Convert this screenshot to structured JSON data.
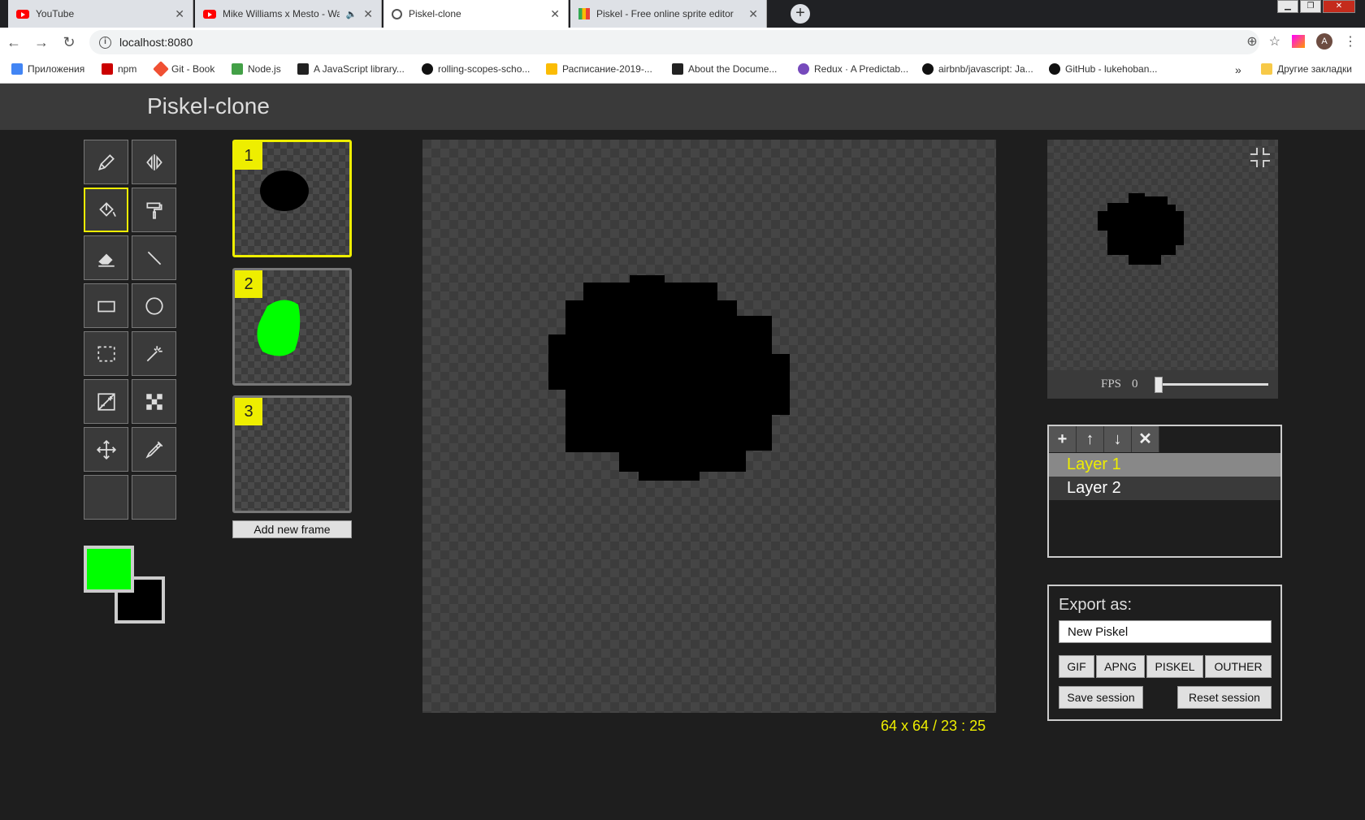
{
  "browser": {
    "tabs": [
      {
        "label": "YouTube",
        "icon": "youtube-icon"
      },
      {
        "label": "Mike Williams x Mesto - Wai",
        "icon": "youtube-icon"
      },
      {
        "label": "Piskel-clone",
        "icon": "globe-icon",
        "active": true
      },
      {
        "label": "Piskel - Free online sprite editor",
        "icon": "piskel-icon"
      }
    ],
    "url": "localhost:8080",
    "avatar_letter": "A",
    "bookmarks": [
      {
        "label": "Приложения",
        "color": "#4285f4"
      },
      {
        "label": "npm",
        "color": "#cb0000"
      },
      {
        "label": "Git - Book",
        "color": "#f05033"
      },
      {
        "label": "Node.js",
        "color": "#43a047"
      },
      {
        "label": "A JavaScript library...",
        "color": "#222222"
      },
      {
        "label": "rolling-scopes-scho...",
        "color": "#111111"
      },
      {
        "label": "Расписание-2019-...",
        "color": "#fbbc04"
      },
      {
        "label": "About the Docume...",
        "color": "#222222"
      },
      {
        "label": "Redux · A Predictab...",
        "color": "#764abc"
      },
      {
        "label": "airbnb/javascript: Ja...",
        "color": "#111111"
      },
      {
        "label": "GitHub - lukehoban...",
        "color": "#111111"
      }
    ],
    "overflow": "»",
    "other_bookmarks": "Другие закладки"
  },
  "app": {
    "title": "Piskel-clone",
    "tools": [
      "pen-icon",
      "mirror-pen-icon",
      "paint-bucket-icon",
      "paint-roller-icon",
      "eraser-icon",
      "line-icon",
      "rectangle-icon",
      "circle-icon",
      "rect-select-icon",
      "magic-wand-icon",
      "lighten-icon",
      "dithering-icon",
      "move-icon",
      "color-picker-icon",
      "empty-tool",
      "empty-tool"
    ],
    "selected_tool": "paint-bucket-icon",
    "primary_color": "#00ff00",
    "secondary_color": "#000000",
    "frames": [
      {
        "number": "1",
        "selected": true,
        "color": "#000000"
      },
      {
        "number": "2",
        "selected": false,
        "color": "#00ee00"
      },
      {
        "number": "3",
        "selected": false,
        "color": null
      }
    ],
    "add_frame_label": "Add new frame",
    "coords": "64 x 64 / 23 : 25",
    "fps_label": "FPS",
    "fps_value": "0",
    "layer_buttons": [
      "+",
      "↑",
      "↓",
      "✕"
    ],
    "layers": [
      {
        "name": "Layer 1",
        "selected": true
      },
      {
        "name": "Layer 2",
        "selected": false
      }
    ],
    "export": {
      "title": "Export as:",
      "name_value": "New Piskel",
      "formats": [
        "GIF",
        "APNG",
        "PISKEL",
        "OUTHER"
      ],
      "save_label": "Save session",
      "reset_label": "Reset session"
    }
  }
}
